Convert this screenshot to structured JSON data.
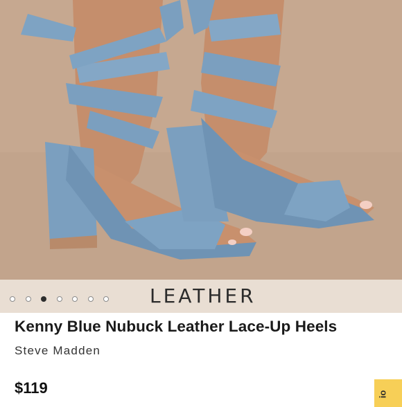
{
  "product": {
    "image_caption": "LEATHER",
    "title": "Kenny Blue Nubuck Leather Lace-Up Heels",
    "brand": "Steve Madden",
    "price": "$119"
  },
  "carousel": {
    "count": 7,
    "active_index": 2
  },
  "side_tab": {
    "label": "io"
  },
  "colors": {
    "shoe_blue": "#7b9fbf",
    "background_tan": "#c2a48c",
    "caption_bar": "#ece2d8",
    "tab_yellow": "#f7cf57"
  }
}
